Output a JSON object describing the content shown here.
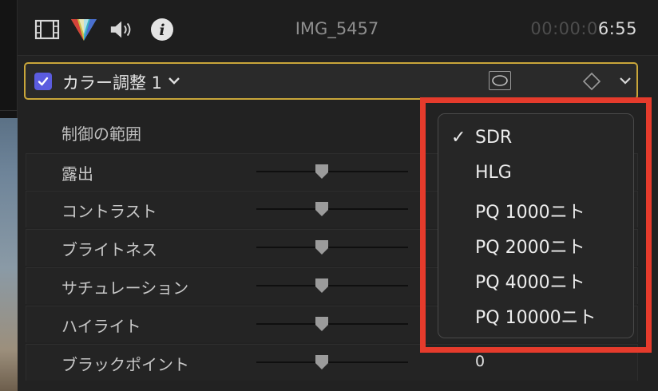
{
  "toolbar": {
    "icons": [
      "film-icon",
      "color-prism-icon",
      "speaker-icon",
      "info-icon"
    ],
    "clip_name": "IMG_5457",
    "timecode_dim": "00:00:0",
    "timecode_bright": "6:55"
  },
  "effect": {
    "enabled": true,
    "title": "カラー調整 1",
    "checkbox_color": "#5b5cdf",
    "highlight_color": "#c9a63a"
  },
  "range": {
    "label": "制御の範囲"
  },
  "params": [
    {
      "label": "露出",
      "value": ""
    },
    {
      "label": "コントラスト",
      "value": ""
    },
    {
      "label": "ブライトネス",
      "value": ""
    },
    {
      "label": "サチュレーション",
      "value": ""
    },
    {
      "label": "ハイライト",
      "value": ""
    },
    {
      "label": "ブラックポイント",
      "value": "0"
    }
  ],
  "popup": {
    "selected": "SDR",
    "check": "✓",
    "options": [
      "SDR",
      "HLG",
      "PQ 1000ニト",
      "PQ 2000ニト",
      "PQ 4000ニト",
      "PQ 10000ニト"
    ]
  },
  "annotation": {
    "color": "#e53b2c"
  }
}
